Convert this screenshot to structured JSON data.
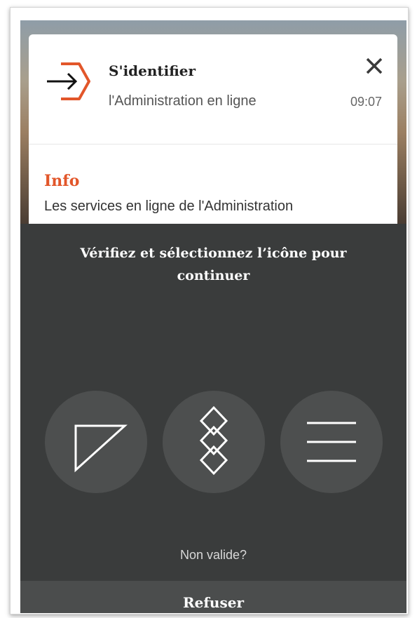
{
  "notification": {
    "title": "S'identifier",
    "subtitle": "l'Administration en ligne",
    "time": "09:07",
    "close_icon": "close-icon",
    "app_icon": "login-arrow-hexagon-icon",
    "accent_color": "#e2562a"
  },
  "info": {
    "heading": "Info",
    "text": "Les services en ligne de l'Administration"
  },
  "verification": {
    "instruction": "Vérifiez et sélectionnez l’icône pour continuer",
    "choices": [
      {
        "icon": "right-triangle-icon"
      },
      {
        "icon": "three-diamonds-icon"
      },
      {
        "icon": "three-lines-icon"
      }
    ],
    "invalid_link": "Non valide?",
    "refuse_label": "Refuser"
  }
}
